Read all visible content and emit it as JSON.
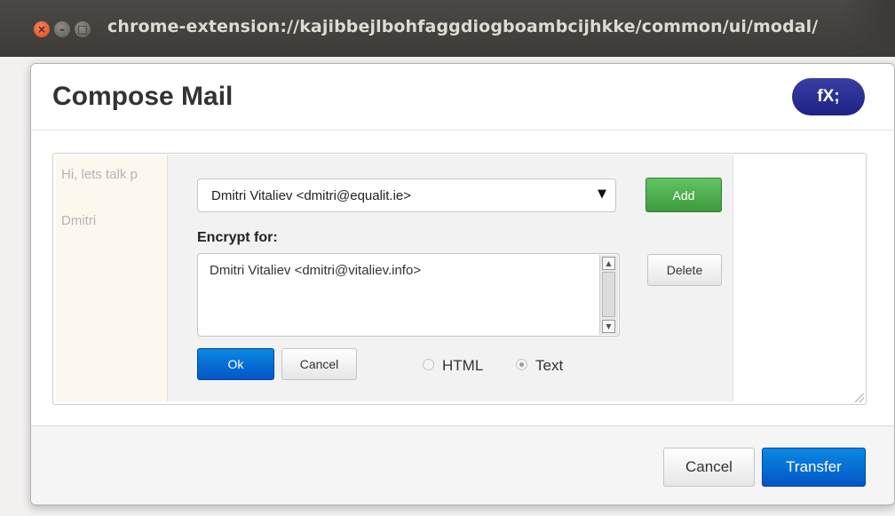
{
  "window": {
    "title": "chrome-extension://kajibbejlbohfaggdiogboambcijhkke/common/ui/modal/"
  },
  "modal": {
    "title": "Compose Mail",
    "badge": "fX;"
  },
  "editor": {
    "body_line": "Hi, lets talk p",
    "signature": "Dmitri"
  },
  "recipients": {
    "selected": "Dmitri Vitaliev <dmitri@equalit.ie>",
    "add_label": "Add",
    "encrypt_label": "Encrypt for:",
    "encrypt_list": [
      "Dmitri Vitaliev <dmitri@vitaliev.info>"
    ],
    "delete_label": "Delete",
    "ok_label": "Ok",
    "cancel_label": "Cancel",
    "format_options": [
      {
        "label": "HTML",
        "checked": false
      },
      {
        "label": "Text",
        "checked": true
      }
    ]
  },
  "footer": {
    "cancel_label": "Cancel",
    "transfer_label": "Transfer"
  },
  "colors": {
    "titlebar": "#3c3b37",
    "primary_button": "#0456c7",
    "add_button": "#3e9a3e",
    "badge": "#1e2287",
    "editor_bg": "#fdf8ee"
  }
}
